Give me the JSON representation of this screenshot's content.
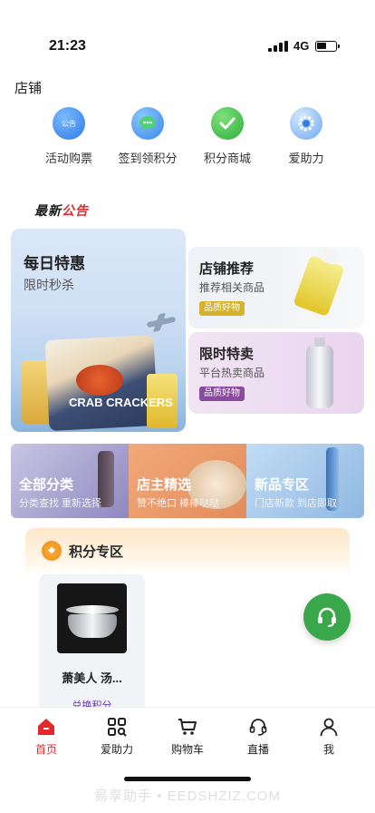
{
  "status_bar": {
    "time": "21:23",
    "network": "4G"
  },
  "shop": {
    "title": "店铺"
  },
  "quick_entries": [
    {
      "label": "活动购票",
      "icon": "megaphone-icon",
      "icon_text": "公告"
    },
    {
      "label": "签到领积分",
      "icon": "chat-bubble-icon"
    },
    {
      "label": "积分商城",
      "icon": "check-badge-icon"
    },
    {
      "label": "爱助力",
      "icon": "gear-icon"
    }
  ],
  "news": {
    "logo_black": "最新",
    "logo_red": "公告"
  },
  "promos": {
    "daily": {
      "title": "每日特惠",
      "subtitle": "限时秒杀",
      "product_text": "CRAB CRACKERS"
    },
    "recommend": {
      "title": "店铺推荐",
      "subtitle": "推荐相关商品",
      "tag": "品质好物"
    },
    "flash": {
      "title": "限时特卖",
      "subtitle": "平台热卖商品",
      "tag": "品质好物"
    }
  },
  "categories": [
    {
      "title": "全部分类",
      "subtitle": "分类查找 重新选择"
    },
    {
      "title": "店主精选",
      "subtitle": "赞不绝口 棒棒哒哒"
    },
    {
      "title": "新品专区",
      "subtitle": "门店新款 到店即取"
    }
  ],
  "points": {
    "title": "积分专区",
    "product": {
      "name": "萧美人 汤...",
      "exchange": "兑换积分"
    }
  },
  "tabbar": [
    {
      "label": "首页",
      "icon": "home-icon",
      "active": true
    },
    {
      "label": "爱助力",
      "icon": "scan-grid-icon",
      "active": false
    },
    {
      "label": "购物车",
      "icon": "cart-icon",
      "active": false
    },
    {
      "label": "直播",
      "icon": "headset-icon",
      "active": false
    },
    {
      "label": "我",
      "icon": "user-icon",
      "active": false
    }
  ],
  "colors": {
    "accent": "#e3282e",
    "fab": "#3aa84a",
    "points_badge": "#ee8a14"
  },
  "watermark": "易享助手 • EEDSHZIZ.COM"
}
